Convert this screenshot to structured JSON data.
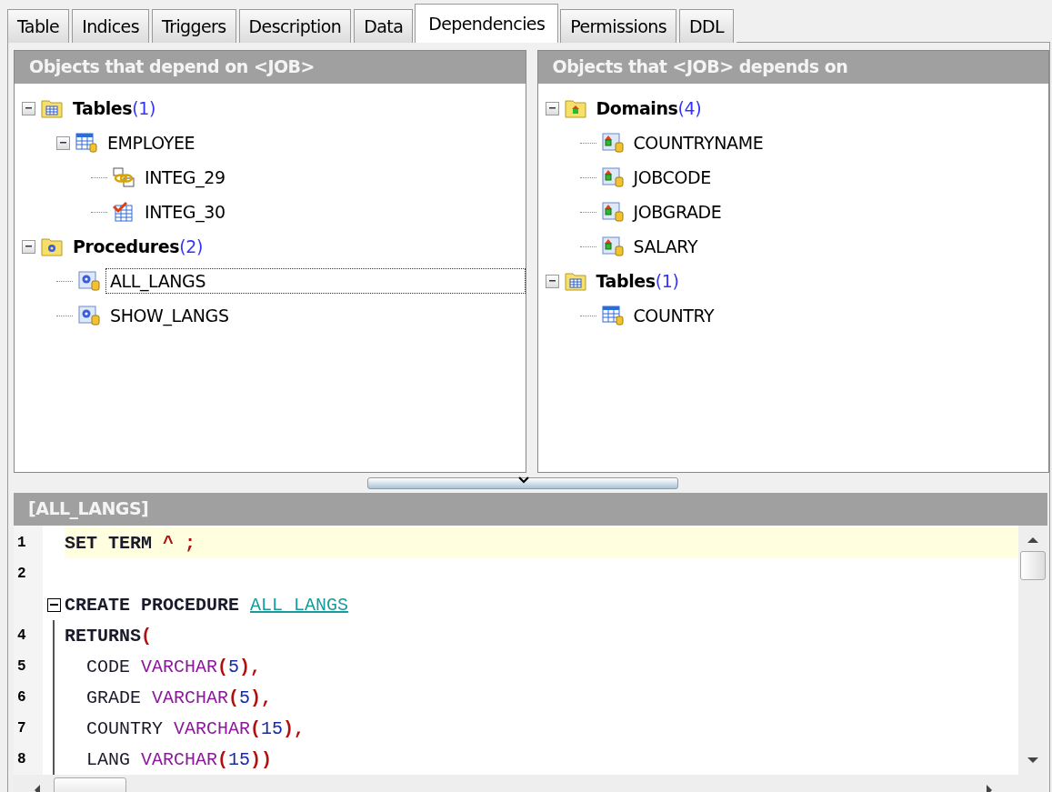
{
  "tabs": [
    {
      "label": "Table",
      "selected": false
    },
    {
      "label": "Indices",
      "selected": false
    },
    {
      "label": "Triggers",
      "selected": false
    },
    {
      "label": "Description",
      "selected": false
    },
    {
      "label": "Data",
      "selected": false
    },
    {
      "label": "Dependencies",
      "selected": true
    },
    {
      "label": "Permissions",
      "selected": false
    },
    {
      "label": "DDL",
      "selected": false
    }
  ],
  "panels": [
    {
      "title": "Objects that depend on <JOB>",
      "tree": [
        {
          "kind": "folder-table",
          "label": "Tables",
          "count": "(1)",
          "expanded": true,
          "selected": false,
          "children": [
            {
              "kind": "table",
              "label": "EMPLOYEE",
              "expanded": true,
              "selected": false,
              "children": [
                {
                  "kind": "foreign-key",
                  "label": "INTEG_29",
                  "selected": false
                },
                {
                  "kind": "check",
                  "label": "INTEG_30",
                  "selected": false
                }
              ]
            }
          ]
        },
        {
          "kind": "folder-procedure",
          "label": "Procedures",
          "count": "(2)",
          "expanded": true,
          "selected": false,
          "children": [
            {
              "kind": "procedure",
              "label": "ALL_LANGS",
              "selected": true
            },
            {
              "kind": "procedure",
              "label": "SHOW_LANGS",
              "selected": false
            }
          ]
        }
      ]
    },
    {
      "title": "Objects that <JOB> depends on",
      "tree": [
        {
          "kind": "folder-domain",
          "label": "Domains",
          "count": "(4)",
          "expanded": true,
          "selected": false,
          "children": [
            {
              "kind": "domain",
              "label": "COUNTRYNAME",
              "selected": false
            },
            {
              "kind": "domain",
              "label": "JOBCODE",
              "selected": false
            },
            {
              "kind": "domain",
              "label": "JOBGRADE",
              "selected": false
            },
            {
              "kind": "domain",
              "label": "SALARY",
              "selected": false
            }
          ]
        },
        {
          "kind": "folder-table",
          "label": "Tables",
          "count": "(1)",
          "expanded": true,
          "selected": false,
          "children": [
            {
              "kind": "table",
              "label": "COUNTRY",
              "selected": false
            }
          ]
        }
      ]
    }
  ],
  "editor": {
    "title": "[ALL_LANGS]",
    "lines": [
      {
        "number": "1",
        "current": true,
        "tokens": [
          {
            "kind": "keyword",
            "text": "SET TERM"
          },
          {
            "kind": "punct",
            "text": " ^ ;"
          }
        ]
      },
      {
        "number": "2",
        "current": false
      },
      {
        "fold": true,
        "current": false,
        "tokens": [
          {
            "kind": "keyword",
            "text": "CREATE PROCEDURE "
          },
          {
            "kind": "name",
            "text": "ALL LANGS"
          }
        ]
      },
      {
        "number": "4",
        "current": false,
        "tokens": [
          {
            "kind": "keyword",
            "text": "RETURNS"
          },
          {
            "kind": "punct",
            "text": "("
          }
        ]
      },
      {
        "number": "5",
        "current": false,
        "tokens": [
          {
            "kind": "plain",
            "text": "  CODE "
          },
          {
            "kind": "type",
            "text": "VARCHAR"
          },
          {
            "kind": "punct",
            "text": "("
          },
          {
            "kind": "number",
            "text": "5"
          },
          {
            "kind": "punct",
            "text": "),"
          }
        ]
      },
      {
        "number": "6",
        "current": false,
        "tokens": [
          {
            "kind": "plain",
            "text": "  GRADE "
          },
          {
            "kind": "type",
            "text": "VARCHAR"
          },
          {
            "kind": "punct",
            "text": "("
          },
          {
            "kind": "number",
            "text": "5"
          },
          {
            "kind": "punct",
            "text": "),"
          }
        ]
      },
      {
        "number": "7",
        "current": false,
        "tokens": [
          {
            "kind": "plain",
            "text": "  COUNTRY "
          },
          {
            "kind": "type",
            "text": "VARCHAR"
          },
          {
            "kind": "punct",
            "text": "("
          },
          {
            "kind": "number",
            "text": "15"
          },
          {
            "kind": "punct",
            "text": "),"
          }
        ]
      },
      {
        "number": "8",
        "current": false,
        "tokens": [
          {
            "kind": "plain",
            "text": "  LANG "
          },
          {
            "kind": "type",
            "text": "VARCHAR"
          },
          {
            "kind": "punct",
            "text": "("
          },
          {
            "kind": "number",
            "text": "15"
          },
          {
            "kind": "punct",
            "text": "))"
          }
        ]
      }
    ]
  }
}
